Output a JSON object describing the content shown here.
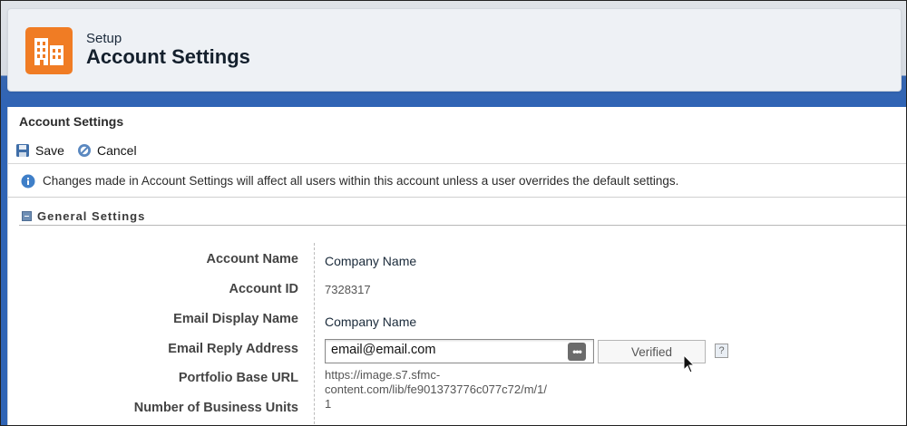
{
  "header": {
    "subtitle": "Setup",
    "title": "Account Settings",
    "icon": "building-icon",
    "icon_color": "#f07c24"
  },
  "panel": {
    "title": "Account Settings"
  },
  "toolbar": {
    "save_label": "Save",
    "cancel_label": "Cancel"
  },
  "info": {
    "icon": "info-icon",
    "text": "Changes made in Account Settings will affect all users within this account unless a user overrides the default settings."
  },
  "section": {
    "title": "General Settings"
  },
  "fields": {
    "account_name": {
      "label": "Account Name",
      "value": "Company Name"
    },
    "account_id": {
      "label": "Account ID",
      "value": "7328317"
    },
    "email_display_name": {
      "label": "Email Display Name",
      "value": "Company Name"
    },
    "email_reply_address": {
      "label": "Email Reply Address",
      "value": "email@email.com",
      "verified_label": "Verified",
      "help_label": "?"
    },
    "portfolio_base_url": {
      "label": "Portfolio Base URL",
      "value_line1": "https://image.s7.sfmc-",
      "value_line2": "content.com/lib/fe901373776c077c72/m/1/",
      "value_line3": "1"
    },
    "business_units": {
      "label": "Number of Business Units"
    }
  }
}
